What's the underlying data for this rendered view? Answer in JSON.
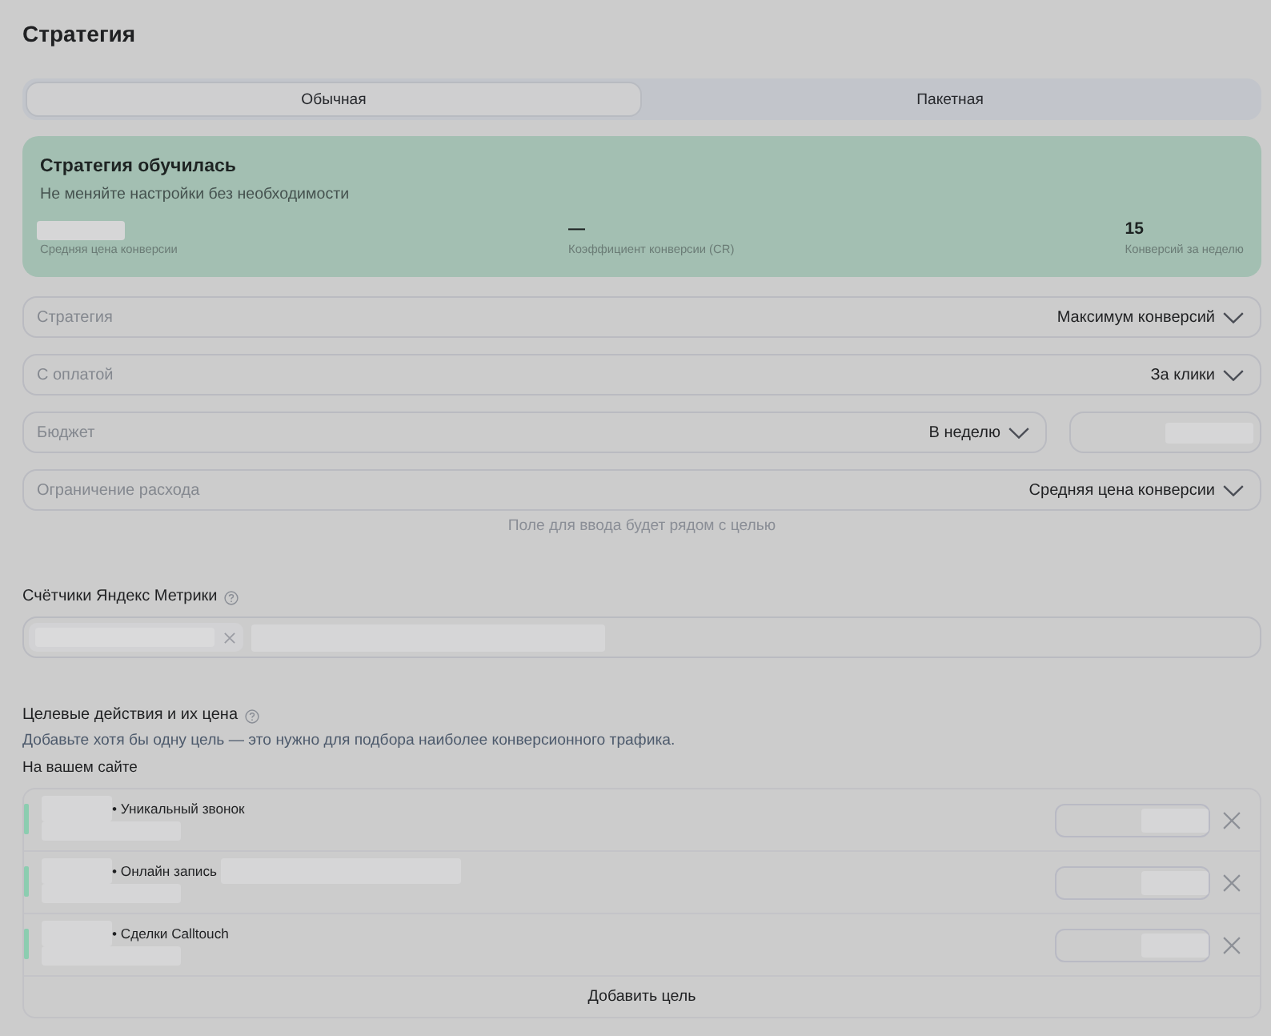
{
  "page": {
    "title": "Стратегия"
  },
  "tabs": [
    {
      "label": "Обычная",
      "selected": true
    },
    {
      "label": "Пакетная",
      "selected": false
    }
  ],
  "status_card": {
    "title": "Стратегия обучилась",
    "subtitle": "Не меняйте настройки без необходимости",
    "metrics": [
      {
        "value_blurred": true,
        "label": "Средняя цена конверсии"
      },
      {
        "value": "—",
        "value_blurred": false,
        "label": "Коэффициент конверсии (CR)"
      },
      {
        "value": "15",
        "value_blurred": false,
        "label": "Конверсий за неделю"
      }
    ]
  },
  "settings": [
    {
      "kind": "select",
      "label": "Стратегия",
      "value": "Максимум конверсий"
    },
    {
      "kind": "select",
      "label": "С оплатой",
      "value": "За клики"
    },
    {
      "kind": "select_with_amount",
      "label": "Бюджет",
      "value": "В неделю",
      "amount_blurred": true
    },
    {
      "kind": "select",
      "label": "Ограничение расхода",
      "value": "Средняя цена конверсии"
    }
  ],
  "settings_hint": "Поле для ввода будет рядом с целью",
  "counters": {
    "title": "Счётчики Яндекс Метрики"
  },
  "goals": {
    "title": "Целевые действия и их цена",
    "description": "Добавьте хотя бы одну цель — это нужно для подбора наиболее конверсионного трафика.",
    "group_title": "На вашем сайте",
    "items": [
      {
        "name": "• Уникальный звонок",
        "note_blurred": false
      },
      {
        "name": "• Онлайн запись",
        "note_blurred": true
      },
      {
        "name": "• Сделки Calltouch",
        "note_blurred": false
      }
    ],
    "add_button": "Добавить цель"
  }
}
